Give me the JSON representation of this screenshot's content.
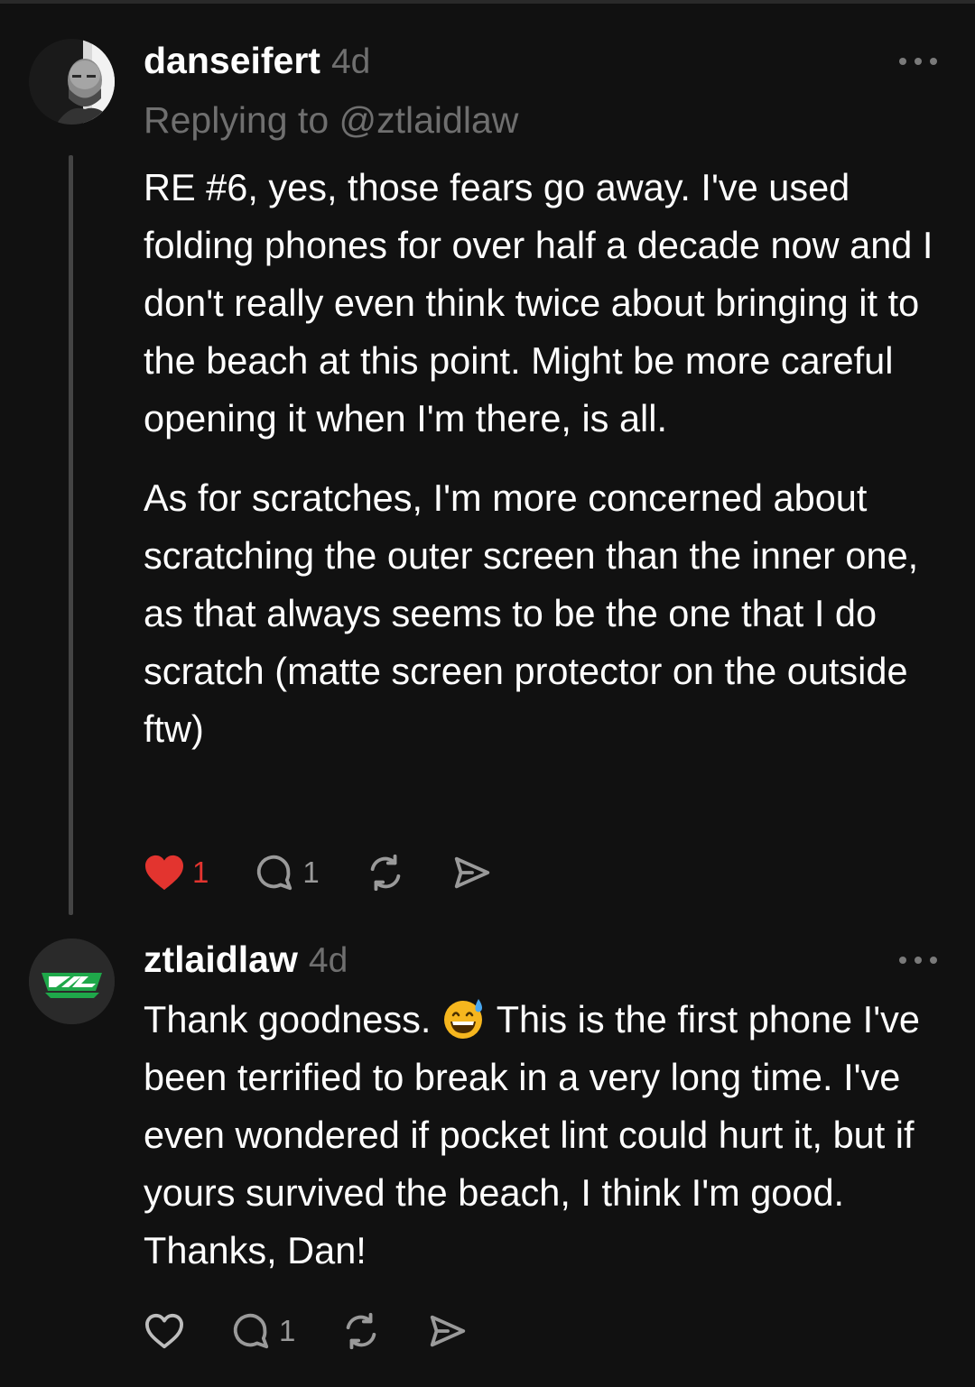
{
  "comments": [
    {
      "username": "danseifert",
      "time": "4d",
      "replying_to": "Replying to @ztlaidlaw",
      "paragraphs": [
        "RE #6, yes, those fears go away. I've used folding phones for over half a decade now and I don't really even think twice about bringing it to the beach at this point. Might be more careful opening it when I'm there, is all.",
        "As for scratches, I'm more concerned about scratching the outer screen than the inner one, as that always seems to be the one that I do scratch (matte screen protector on the outside ftw)"
      ],
      "likes": "1",
      "liked": true,
      "replies": "1",
      "avatar_icon": "user-photo-avatar"
    },
    {
      "username": "ztlaidlaw",
      "time": "4d",
      "text_before_emoji": "Thank goodness. ",
      "emoji": "grinning-face-with-sweat-emoji",
      "text_after_emoji": " This is the first phone I've been terrified to break in a very long time. I've even wondered if pocket lint could hurt it, but if yours survived the beach, I think I'm good. Thanks, Dan!",
      "likes": "",
      "liked": false,
      "replies": "1",
      "avatar_icon": "zl-logo-avatar"
    }
  ],
  "colors": {
    "background": "#111111",
    "text": "#ffffff",
    "muted": "#6f6f6f",
    "like_red": "#e3342f",
    "thread_line": "#444444",
    "logo_green": "#1fa84a"
  }
}
